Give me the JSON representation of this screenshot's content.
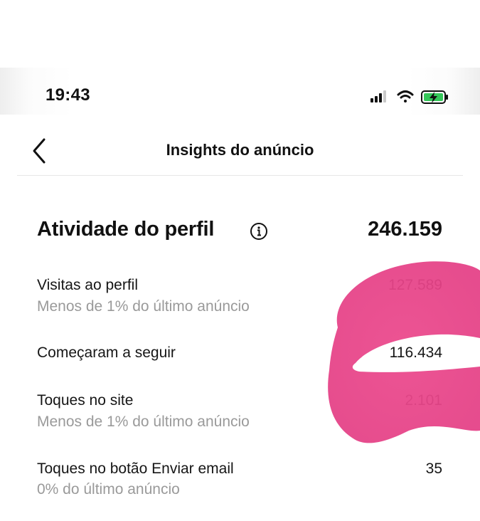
{
  "status_bar": {
    "time": "19:43",
    "icons": [
      "signal-icon",
      "wifi-icon",
      "battery-charging-icon"
    ],
    "battery_color": "#34c759"
  },
  "nav": {
    "back_icon": "chevron-left-icon",
    "title": "Insights do anúncio"
  },
  "section": {
    "title": "Atividade do perfil",
    "info_icon": "info-icon",
    "total": "246.159"
  },
  "rows": [
    {
      "label": "Visitas ao perfil",
      "sub": "Menos de 1% do último anúncio",
      "value": "127.589"
    },
    {
      "label": "Começaram a seguir",
      "sub": "",
      "value": "116.434"
    },
    {
      "label": "Toques no site",
      "sub": "Menos de 1% do último anúncio",
      "value": "2.101"
    },
    {
      "label": "Toques no botão Enviar email",
      "sub": "0% do último anúncio",
      "value": "35"
    }
  ],
  "colors": {
    "scribble": "#e8478a",
    "subtext": "#9a9a9a"
  }
}
